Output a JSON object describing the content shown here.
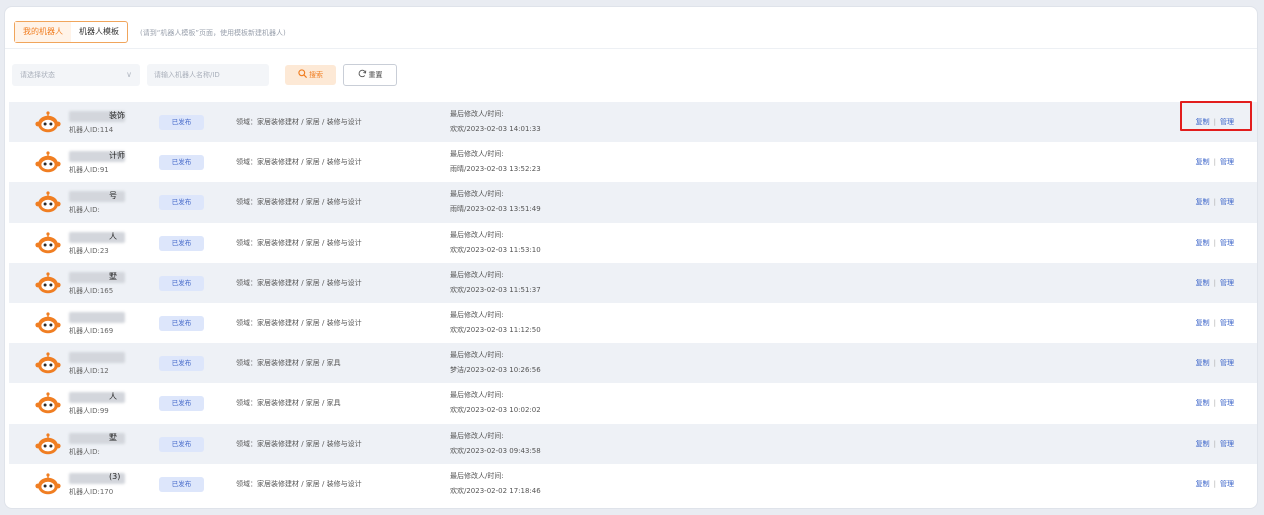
{
  "tabs": [
    {
      "label": "我的机器人",
      "active": true
    },
    {
      "label": "机器人模板",
      "active": false
    }
  ],
  "tab_hint": "(请到“机器人模板”页面，使用模板新建机器人)",
  "filters": {
    "status_placeholder": "请选择状态",
    "search_placeholder": "请输入机器人名称/ID",
    "search_button": "搜索",
    "reset_button": "重置"
  },
  "colors": {
    "accent": "#f07e22",
    "link": "#3a63c9",
    "tag_bg": "#dde6fb",
    "highlight": "#e21d1d"
  },
  "rows": [
    {
      "name_suffix": "装饰",
      "id_label": "机器人ID:114",
      "status": "已发布",
      "domain": "领域：家居装修建材 / 家居 / 装修与设计",
      "modified_label": "最后修改人/时间:",
      "modified_value": "欢欢/2023-02-03 14:01:33",
      "copy": "复制",
      "manage": "管理"
    },
    {
      "name_suffix": "计师",
      "id_label": "机器人ID:91",
      "status": "已发布",
      "domain": "领域：家居装修建材 / 家居 / 装修与设计",
      "modified_label": "最后修改人/时间:",
      "modified_value": "雨晴/2023-02-03 13:52:23",
      "copy": "复制",
      "manage": "管理"
    },
    {
      "name_suffix": "号",
      "id_label": "机器人ID:",
      "status": "已发布",
      "domain": "领域：家居装修建材 / 家居 / 装修与设计",
      "modified_label": "最后修改人/时间:",
      "modified_value": "雨晴/2023-02-03 13:51:49",
      "copy": "复制",
      "manage": "管理"
    },
    {
      "name_suffix": "人",
      "id_label": "机器人ID:23",
      "status": "已发布",
      "domain": "领域：家居装修建材 / 家居 / 装修与设计",
      "modified_label": "最后修改人/时间:",
      "modified_value": "欢欢/2023-02-03 11:53:10",
      "copy": "复制",
      "manage": "管理"
    },
    {
      "name_suffix": "墅",
      "id_label": "机器人ID:165",
      "status": "已发布",
      "domain": "领域：家居装修建材 / 家居 / 装修与设计",
      "modified_label": "最后修改人/时间:",
      "modified_value": "欢欢/2023-02-03 11:51:37",
      "copy": "复制",
      "manage": "管理"
    },
    {
      "name_suffix": "",
      "id_label": "机器人ID:169",
      "status": "已发布",
      "domain": "领域：家居装修建材 / 家居 / 装修与设计",
      "modified_label": "最后修改人/时间:",
      "modified_value": "欢欢/2023-02-03 11:12:50",
      "copy": "复制",
      "manage": "管理"
    },
    {
      "name_suffix": "",
      "id_label": "机器人ID:12",
      "status": "已发布",
      "domain": "领域：家居装修建材 / 家居 / 家具",
      "modified_label": "最后修改人/时间:",
      "modified_value": "梦洁/2023-02-03 10:26:56",
      "copy": "复制",
      "manage": "管理"
    },
    {
      "name_suffix": "人",
      "id_label": "机器人ID:99",
      "status": "已发布",
      "domain": "领域：家居装修建材 / 家居 / 家具",
      "modified_label": "最后修改人/时间:",
      "modified_value": "欢欢/2023-02-03 10:02:02",
      "copy": "复制",
      "manage": "管理"
    },
    {
      "name_suffix": "墅",
      "id_label": "机器人ID:",
      "status": "已发布",
      "domain": "领域：家居装修建材 / 家居 / 装修与设计",
      "modified_label": "最后修改人/时间:",
      "modified_value": "欢欢/2023-02-03 09:43:58",
      "copy": "复制",
      "manage": "管理"
    },
    {
      "name_suffix": "(3)",
      "id_label": "机器人ID:170",
      "status": "已发布",
      "domain": "领域：家居装修建材 / 家居 / 装修与设计",
      "modified_label": "最后修改人/时间:",
      "modified_value": "欢欢/2023-02-02 17:18:46",
      "copy": "复制",
      "manage": "管理"
    }
  ]
}
